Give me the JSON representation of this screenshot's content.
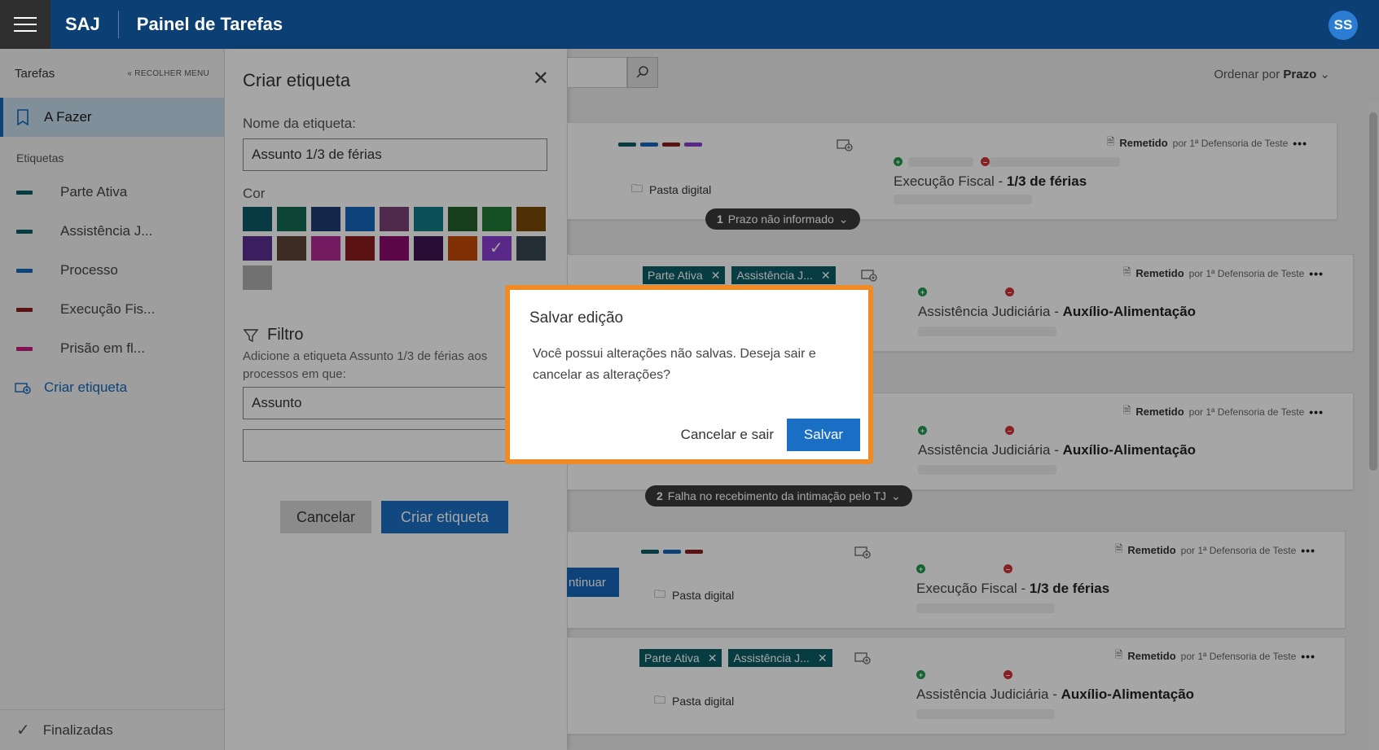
{
  "header": {
    "brand": "SAJ",
    "title": "Painel de Tarefas",
    "avatar_initials": "SS"
  },
  "sidebar": {
    "title": "Tarefas",
    "collapse_label": "RECOLHER MENU",
    "active_item": "A Fazer",
    "section_label": "Etiquetas",
    "tags": [
      {
        "label": "Parte Ativa",
        "color": "#0b5f66"
      },
      {
        "label": "Assistência J...",
        "color": "#0b5f66"
      },
      {
        "label": "Processo",
        "color": "#1468b8"
      },
      {
        "label": "Execução Fis...",
        "color": "#8a1c1c"
      },
      {
        "label": "Prisão em fl...",
        "color": "#c81e7f"
      }
    ],
    "create_label": "Criar etiqueta",
    "footer_label": "Finalizadas"
  },
  "panel": {
    "title": "Criar etiqueta",
    "name_label": "Nome da etiqueta:",
    "name_value": "Assunto 1/3 de férias",
    "color_label": "Cor",
    "colors": [
      "#0b5a66",
      "#136b54",
      "#1e3c72",
      "#1468b8",
      "#7a3f75",
      "#117b84",
      "#22602a",
      "#1e7a36",
      "#7a4a07",
      "#5a2e91",
      "#5e4437",
      "#b32b96",
      "#8a1c1c",
      "#8a0a6e",
      "#3e1450",
      "#c44a07",
      "#8a3fd0",
      "#364550",
      "#b0b0b0"
    ],
    "selected_color_index": 16,
    "filter_title": "Filtro",
    "filter_desc": "Adicione a etiqueta Assunto 1/3 de férias aos processos em que:",
    "filter_field_value": "Assunto",
    "cancel_label": "Cancelar",
    "create_label": "Criar etiqueta"
  },
  "main": {
    "sort_prefix": "Ordenar por",
    "sort_value": "Prazo",
    "continue_label": "ntinuar",
    "cards": [
      {
        "remetido": "Remetido",
        "by": "por 1ª Defensoria de Teste",
        "subject_a": "Execução Fiscal - ",
        "subject_b": "1/3 de férias",
        "pasta": "Pasta digital"
      },
      {
        "remetido": "Remetido",
        "by": "por 1ª Defensoria de Teste",
        "subject_a": "Assistência Judiciária - ",
        "subject_b": "Auxílio-Alimentação",
        "chip1": "Parte Ativa",
        "chip2": "Assistência J..."
      },
      {
        "remetido": "Remetido",
        "by": "por 1ª Defensoria de Teste",
        "subject_a": "Assistência Judiciária - ",
        "subject_b": "Auxílio-Alimentação"
      },
      {
        "remetido": "Remetido",
        "by": "por 1ª Defensoria de Teste",
        "subject_a": "Execução Fiscal - ",
        "subject_b": "1/3 de férias",
        "pasta": "Pasta digital"
      },
      {
        "remetido": "Remetido",
        "by": "por 1ª Defensoria de Teste",
        "subject_a": "Assistência Judiciária - ",
        "subject_b": "Auxílio-Alimentação",
        "chip1": "Parte Ativa",
        "chip2": "Assistência J...",
        "pasta": "Pasta digital"
      }
    ],
    "pill1_count": "1",
    "pill1_text": "Prazo não informado",
    "pill2_count": "2",
    "pill2_text": "Falha no recebimento da intimação pelo TJ"
  },
  "dialog": {
    "title": "Salvar edição",
    "message": "Você possui alterações não salvas. Deseja sair e cancelar as alterações?",
    "cancel_label": "Cancelar e sair",
    "save_label": "Salvar"
  }
}
